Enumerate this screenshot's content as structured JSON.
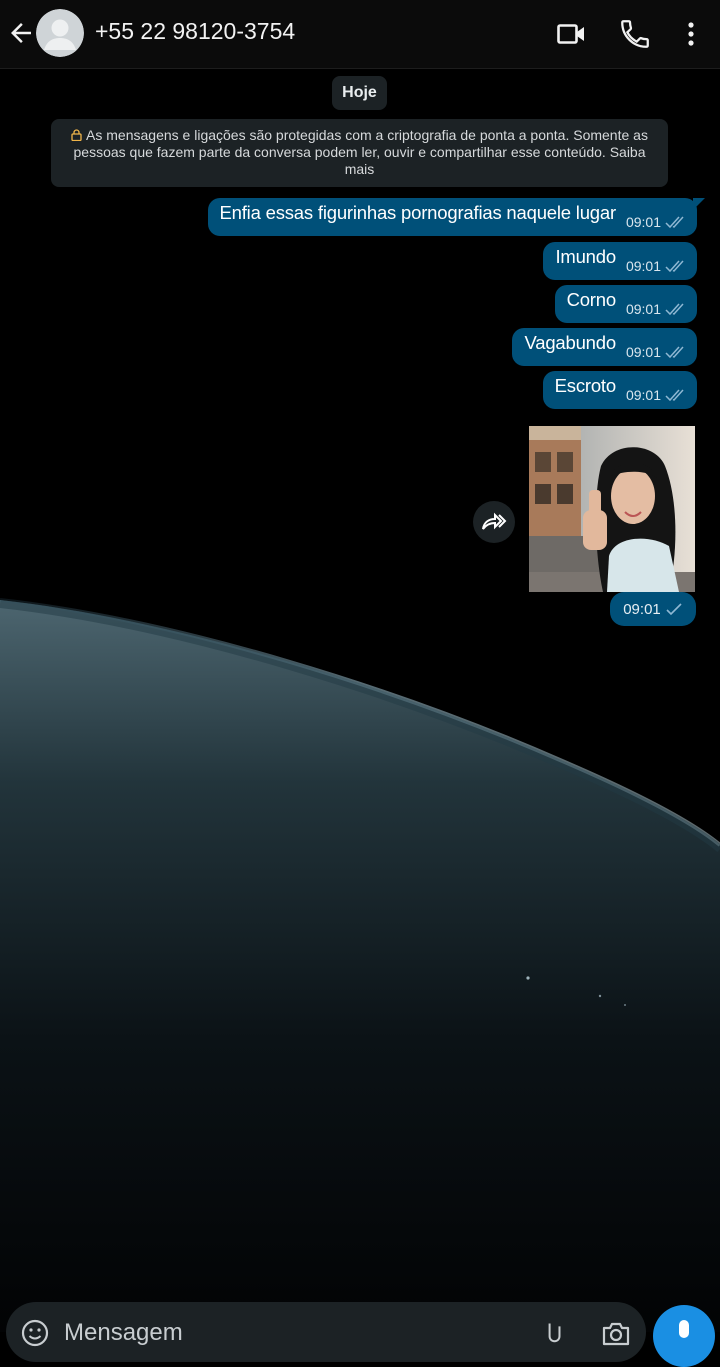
{
  "header": {
    "contact_name": "+55 22 98120-3754",
    "icons": [
      "back-arrow-icon",
      "avatar",
      "video-call-icon",
      "phone-icon",
      "more-vert-icon"
    ]
  },
  "chat": {
    "date_chip": "Hoje",
    "encryption_notice": "As mensagens e ligações são protegidas com a criptografia de ponta a ponta. Somente as pessoas que fazem parte da conversa podem ler, ouvir e compartilhar esse conteúdo. Saiba mais",
    "messages": [
      {
        "text": "Enfia essas figurinhas pornografias naquele lugar",
        "time": "09:01",
        "status": "sent"
      },
      {
        "text": "Imundo",
        "time": "09:01",
        "status": "sent"
      },
      {
        "text": "Corno",
        "time": "09:01",
        "status": "sent"
      },
      {
        "text": "Vagabundo",
        "time": "09:01",
        "status": "sent"
      },
      {
        "text": "Escroto",
        "time": "09:01",
        "status": "sent"
      }
    ],
    "photo_message": {
      "time": "09:01",
      "status": "sent",
      "description": "photo"
    }
  },
  "composer": {
    "placeholder": "Mensagem"
  },
  "colors": {
    "bubble_out": "#005079",
    "chip_bg": "#1c2225",
    "tick": "#8fb8d3",
    "mic_button": "#1a8fe3"
  }
}
